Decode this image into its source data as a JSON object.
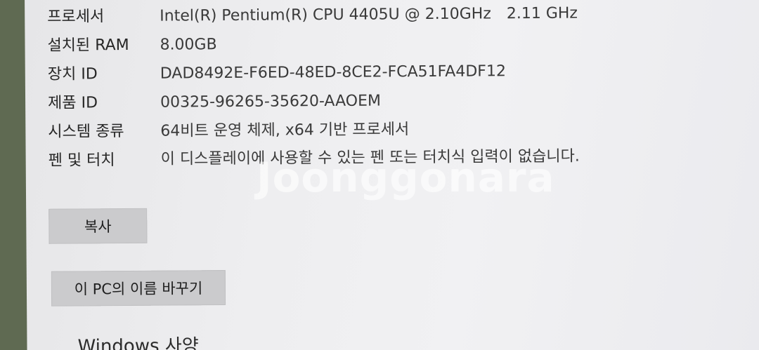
{
  "specs": [
    {
      "label": "프로세서",
      "value": "Intel(R) Pentium(R) CPU 4405U @ 2.10GHz",
      "extra": "2.11 GHz"
    },
    {
      "label": "설치된 RAM",
      "value": "8.00GB"
    },
    {
      "label": "장치 ID",
      "value": "DAD8492E-F6ED-48ED-8CE2-FCA51FA4DF12"
    },
    {
      "label": "제품 ID",
      "value": "00325-96265-35620-AAOEM"
    },
    {
      "label": "시스템 종류",
      "value": "64비트 운영 체제, x64 기반 프로세서"
    },
    {
      "label": "펜 및 터치",
      "value": "이 디스플레이에 사용할 수 있는 펜 또는 터치식 입력이 없습니다."
    }
  ],
  "buttons": {
    "copy_label": "복사",
    "rename_label": "이 PC의 이름 바꾸기"
  },
  "watermark": "Joonggonara",
  "next_section_partial": "Windows 사양"
}
